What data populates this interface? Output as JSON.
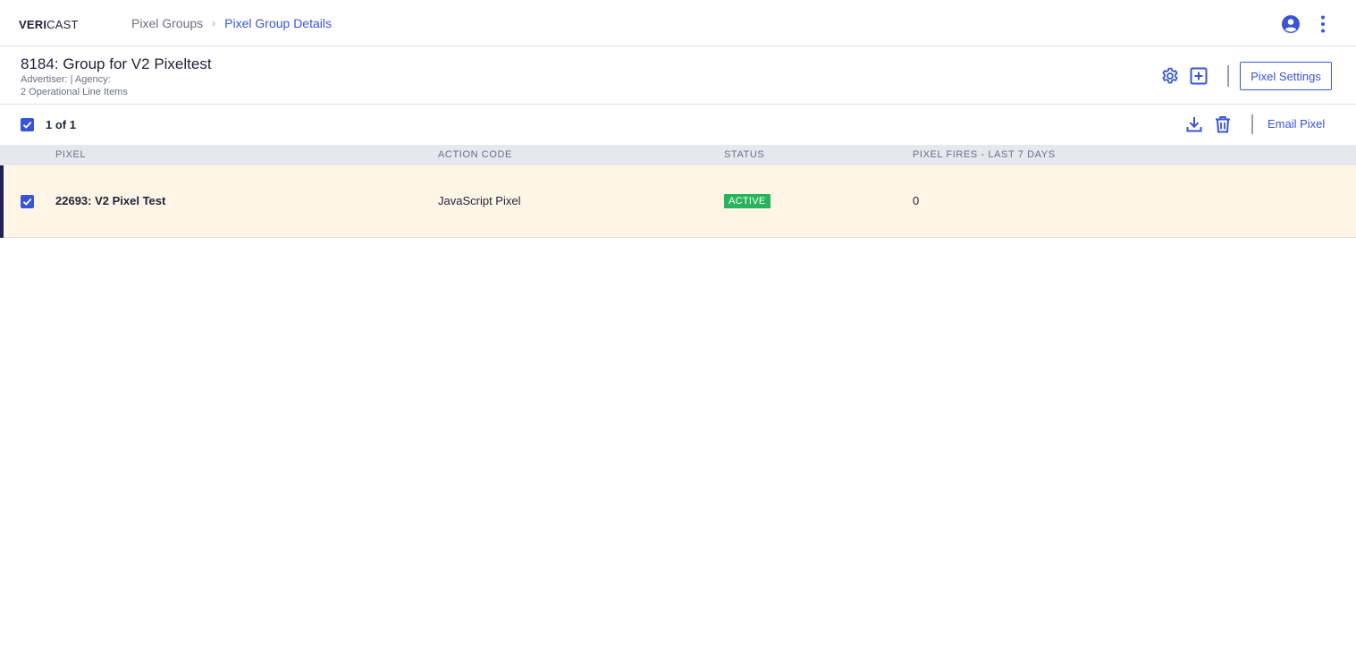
{
  "nav": {
    "logo_bold": "VERI",
    "logo_light": "CAST",
    "breadcrumb": [
      {
        "label": "Pixel Groups"
      },
      {
        "label": "Pixel Group Details"
      }
    ]
  },
  "header": {
    "title": "8184: Group for V2 Pixeltest",
    "meta_line1": "Advertiser:  | Agency:",
    "meta_line2": "2 Operational Line Items",
    "pixel_settings_label": "Pixel Settings"
  },
  "selection": {
    "count_label": "1 of 1",
    "email_label": "Email Pixel"
  },
  "table": {
    "columns": [
      "Pixel",
      "Action Code",
      "Status",
      "Pixel Fires - Last 7 Days"
    ],
    "rows": [
      {
        "pixel": "22693: V2 Pixel Test",
        "action_code": "JavaScript Pixel",
        "status": "ACTIVE",
        "fires": "0",
        "selected": true
      }
    ]
  },
  "colors": {
    "accent": "#3a54d6",
    "active_status": "#28b45a",
    "selected_row_bg": "#fff5e6",
    "row_accent": "#1c2455"
  },
  "icons": [
    "account-icon",
    "kebab-menu-icon",
    "gear-icon",
    "add-box-icon",
    "download-icon",
    "trash-icon",
    "checkbox-checked-icon"
  ]
}
